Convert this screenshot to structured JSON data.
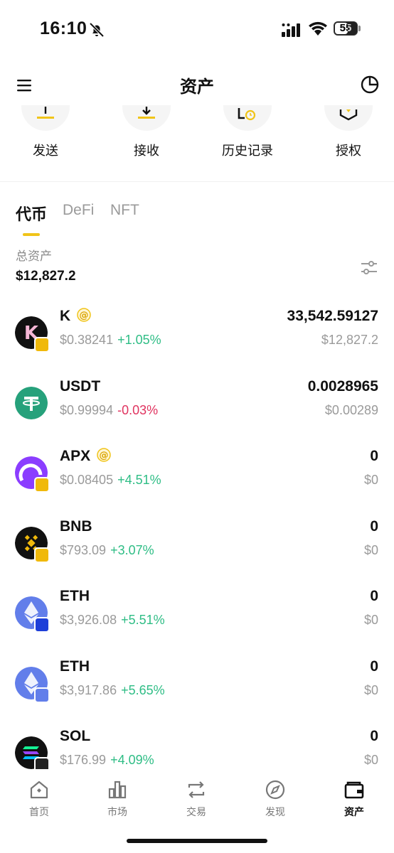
{
  "status_bar": {
    "time": "16:10",
    "battery": "55"
  },
  "header": {
    "title": "资产"
  },
  "actions": [
    {
      "label": "发送",
      "icon": "send-icon"
    },
    {
      "label": "接收",
      "icon": "receive-icon"
    },
    {
      "label": "历史记录",
      "icon": "history-icon"
    },
    {
      "label": "授权",
      "icon": "authorize-icon"
    }
  ],
  "tabs": [
    {
      "label": "代币",
      "active": true
    },
    {
      "label": "DeFi",
      "active": false
    },
    {
      "label": "NFT",
      "active": false
    }
  ],
  "total": {
    "label": "总资产",
    "value": "$12,827.2"
  },
  "tokens": [
    {
      "symbol": "K",
      "price": "$0.38241",
      "change": "+1.05%",
      "direction": "up",
      "balance": "33,542.59127",
      "value": "$12,827.2",
      "has_at": true
    },
    {
      "symbol": "USDT",
      "price": "$0.99994",
      "change": "-0.03%",
      "direction": "down",
      "balance": "0.0028965",
      "value": "$0.00289",
      "has_at": false
    },
    {
      "symbol": "APX",
      "price": "$0.08405",
      "change": "+4.51%",
      "direction": "up",
      "balance": "0",
      "value": "$0",
      "has_at": true
    },
    {
      "symbol": "BNB",
      "price": "$793.09",
      "change": "+3.07%",
      "direction": "up",
      "balance": "0",
      "value": "$0",
      "has_at": false
    },
    {
      "symbol": "ETH",
      "price": "$3,926.08",
      "change": "+5.51%",
      "direction": "up",
      "balance": "0",
      "value": "$0",
      "has_at": false
    },
    {
      "symbol": "ETH",
      "price": "$3,917.86",
      "change": "+5.65%",
      "direction": "up",
      "balance": "0",
      "value": "$0",
      "has_at": false
    },
    {
      "symbol": "SOL",
      "price": "$176.99",
      "change": "+4.09%",
      "direction": "up",
      "balance": "0",
      "value": "$0",
      "has_at": false
    }
  ],
  "bottom_nav": [
    {
      "label": "首页",
      "icon": "home-icon",
      "active": false
    },
    {
      "label": "市场",
      "icon": "market-chart-icon",
      "active": false
    },
    {
      "label": "交易",
      "icon": "swap-icon",
      "active": false
    },
    {
      "label": "发现",
      "icon": "compass-icon",
      "active": false
    },
    {
      "label": "资产",
      "icon": "wallet-icon",
      "active": true
    }
  ],
  "colors": {
    "accent": "#f0c419",
    "up": "#2ebd85",
    "down": "#e0335f"
  }
}
